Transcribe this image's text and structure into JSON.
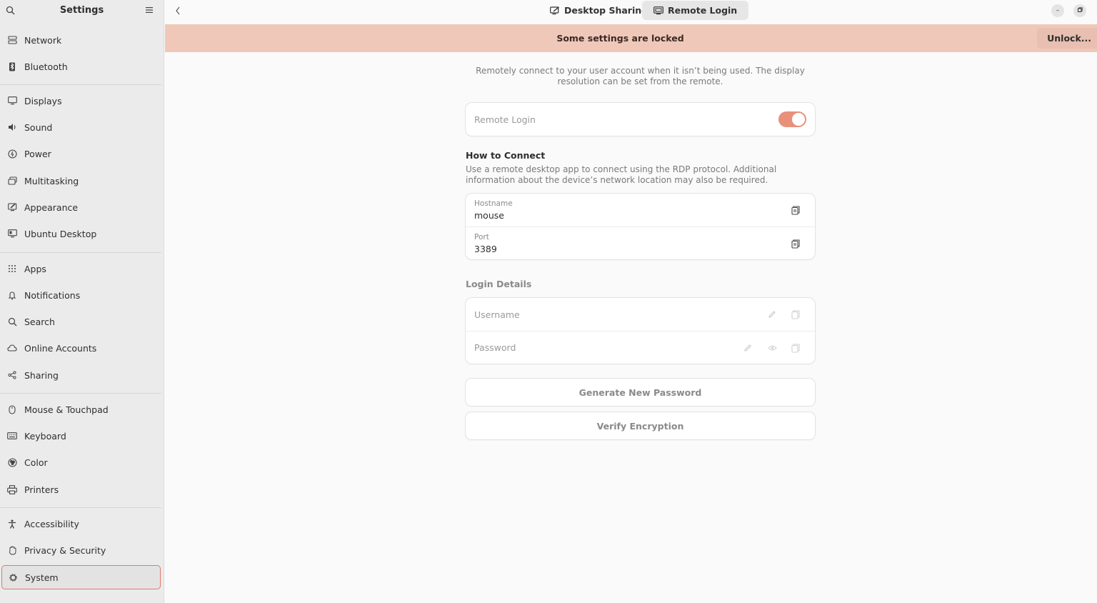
{
  "sidebar": {
    "title": "Settings",
    "items": [
      {
        "label": "Network",
        "icon": "network-icon"
      },
      {
        "label": "Bluetooth",
        "icon": "bluetooth-icon"
      },
      {
        "label": "Displays",
        "icon": "display-icon"
      },
      {
        "label": "Sound",
        "icon": "speaker-icon"
      },
      {
        "label": "Power",
        "icon": "power-icon"
      },
      {
        "label": "Multitasking",
        "icon": "multitasking-icon"
      },
      {
        "label": "Appearance",
        "icon": "appearance-icon"
      },
      {
        "label": "Ubuntu Desktop",
        "icon": "ubuntu-desktop-icon"
      },
      {
        "label": "Apps",
        "icon": "apps-grid-icon"
      },
      {
        "label": "Notifications",
        "icon": "bell-icon"
      },
      {
        "label": "Search",
        "icon": "search-icon"
      },
      {
        "label": "Online Accounts",
        "icon": "cloud-icon"
      },
      {
        "label": "Sharing",
        "icon": "share-icon"
      },
      {
        "label": "Mouse & Touchpad",
        "icon": "mouse-icon"
      },
      {
        "label": "Keyboard",
        "icon": "keyboard-icon"
      },
      {
        "label": "Color",
        "icon": "color-icon"
      },
      {
        "label": "Printers",
        "icon": "printer-icon"
      },
      {
        "label": "Accessibility",
        "icon": "accessibility-icon"
      },
      {
        "label": "Privacy & Security",
        "icon": "hand-icon"
      },
      {
        "label": "System",
        "icon": "gear-icon"
      }
    ],
    "active": "System"
  },
  "header": {
    "tabs": [
      {
        "label": "Desktop Sharing",
        "selected": false
      },
      {
        "label": "Remote Login",
        "selected": true
      }
    ]
  },
  "banner": {
    "text": "Some settings are locked",
    "unlock_label": "Unlock..."
  },
  "main": {
    "description": "Remotely connect to your user account when it isn’t being used. The display resolution can be set from the remote.",
    "remote_login": {
      "label": "Remote Login",
      "enabled": true
    },
    "how_to_connect": {
      "title": "How to Connect",
      "description": "Use a remote desktop app to connect using the RDP protocol. Additional information about the device’s network location may also be required.",
      "hostname_label": "Hostname",
      "hostname_value": "mouse",
      "port_label": "Port",
      "port_value": "3389"
    },
    "login_details": {
      "title": "Login Details",
      "username_label": "Username",
      "password_label": "Password"
    },
    "generate_password_label": "Generate New Password",
    "verify_encryption_label": "Verify Encryption"
  },
  "colors": {
    "accent": "#e9907a",
    "banner_bg": "#f0c8b9",
    "sidebar_bg": "#ebebeb"
  }
}
